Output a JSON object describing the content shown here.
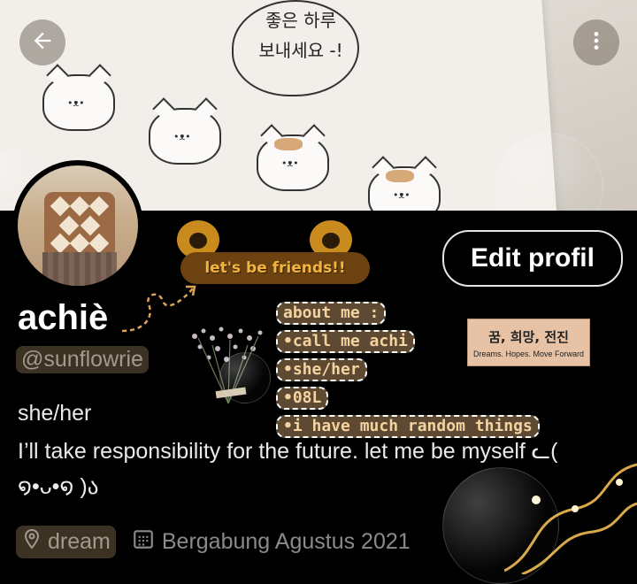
{
  "banner": {
    "speech_line1": "좋은 하루",
    "speech_line2": "보내세요 -!"
  },
  "header": {
    "back_icon": "arrow-left-icon",
    "more_icon": "more-vertical-icon"
  },
  "profile": {
    "edit_label": "Edit profil",
    "sticker_text": "let's be friends!!",
    "name": "achiè",
    "handle": "@sunflowrie",
    "pronouns": "she/her",
    "bio": "I’ll take responsibility for the future. let me be myself ᓚ( ໑•ᴗ•໑ )ა",
    "about": [
      "about me :",
      "•call me achi",
      "•she/her",
      "•08L",
      "•i have much random things"
    ],
    "card_korean": "꿈, 희망, 전진",
    "card_english": "Dreams. Hopes. Move Forward",
    "location": "dream",
    "location_icon": "location-pin-icon",
    "joined": "Bergabung Agustus 2021",
    "joined_icon": "calendar-icon"
  },
  "colors": {
    "accent_brown": "#6b4210",
    "highlight": "#3b3224",
    "muted_text": "#8a8a8a"
  }
}
